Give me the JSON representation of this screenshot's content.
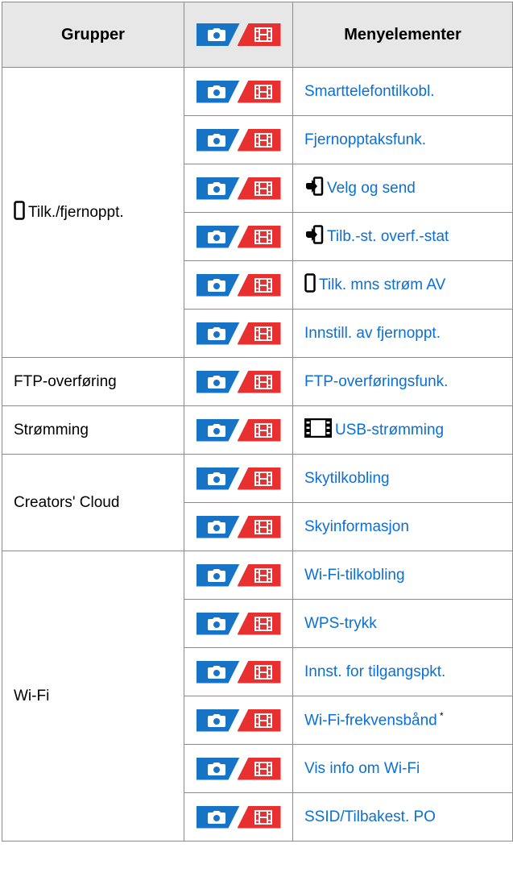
{
  "header": {
    "groups": "Grupper",
    "items": "Menyelementer"
  },
  "groups": [
    {
      "label": "Tilk./fjernoppt.",
      "icon": "smartphone-icon",
      "items": [
        {
          "label": "Smarttelefontilkobl."
        },
        {
          "label": "Fjernopptaksfunk."
        },
        {
          "label": "Velg og send",
          "icon": "send-to-phone-icon"
        },
        {
          "label": "Tilb.-st. overf.-stat",
          "icon": "send-to-phone-icon"
        },
        {
          "label": "Tilk. mns strøm AV",
          "icon": "smartphone-icon"
        },
        {
          "label": "Innstill. av fjernoppt."
        }
      ]
    },
    {
      "label": "FTP-overføring",
      "items": [
        {
          "label": "FTP-overføringsfunk."
        }
      ]
    },
    {
      "label": "Strømming",
      "items": [
        {
          "label": "USB-strømming",
          "icon": "film-icon"
        }
      ]
    },
    {
      "label": "Creators' Cloud",
      "items": [
        {
          "label": "Skytilkobling"
        },
        {
          "label": "Skyinformasjon"
        }
      ]
    },
    {
      "label": "Wi-Fi",
      "items": [
        {
          "label": "Wi-Fi-tilkobling"
        },
        {
          "label": "WPS-trykk"
        },
        {
          "label": "Innst. for tilgangspkt."
        },
        {
          "label": "Wi-Fi-frekvensbånd",
          "note": "*"
        },
        {
          "label": "Vis info om Wi-Fi"
        },
        {
          "label": "SSID/Tilbakest. PO"
        }
      ]
    }
  ],
  "colors": {
    "link": "#0a6fd8",
    "photo_badge": "#1673c5",
    "movie_badge": "#e83030",
    "header_bg": "#e7e7e7"
  }
}
